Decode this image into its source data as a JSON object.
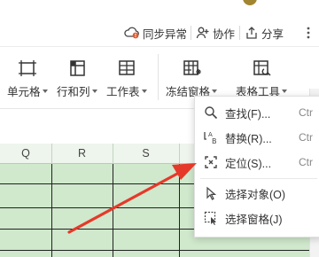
{
  "topbar": {
    "sync_label": "同步异常",
    "collab_label": "协作",
    "share_label": "分享"
  },
  "ribbon": {
    "buttons": [
      {
        "label": "单元格",
        "icon": "cell-icon"
      },
      {
        "label": "行和列",
        "icon": "row-col-icon"
      },
      {
        "label": "工作表",
        "icon": "worksheet-icon"
      },
      {
        "label": "冻结窗格",
        "icon": "freeze-pane-icon"
      },
      {
        "label": "表格工具",
        "icon": "table-tools-icon"
      }
    ]
  },
  "sheet": {
    "columns": [
      "Q",
      "R",
      "S",
      "T"
    ]
  },
  "context_menu": {
    "items": [
      {
        "label": "查找(F)...",
        "shortcut": "Ctr",
        "icon": "search-icon"
      },
      {
        "label": "替换(R)...",
        "shortcut": "Ctr",
        "icon": "replace-icon"
      },
      {
        "label": "定位(S)...",
        "shortcut": "Ctr",
        "icon": "locate-icon"
      },
      {
        "label": "选择对象(O)",
        "shortcut": "",
        "icon": "select-object-icon"
      },
      {
        "label": "选择窗格(J)",
        "shortcut": "",
        "icon": "selection-pane-icon"
      }
    ]
  },
  "colors": {
    "sheet_fill": "#d0e8cc",
    "arrow": "#e5392a",
    "sync_warning": "#e05a2b"
  }
}
